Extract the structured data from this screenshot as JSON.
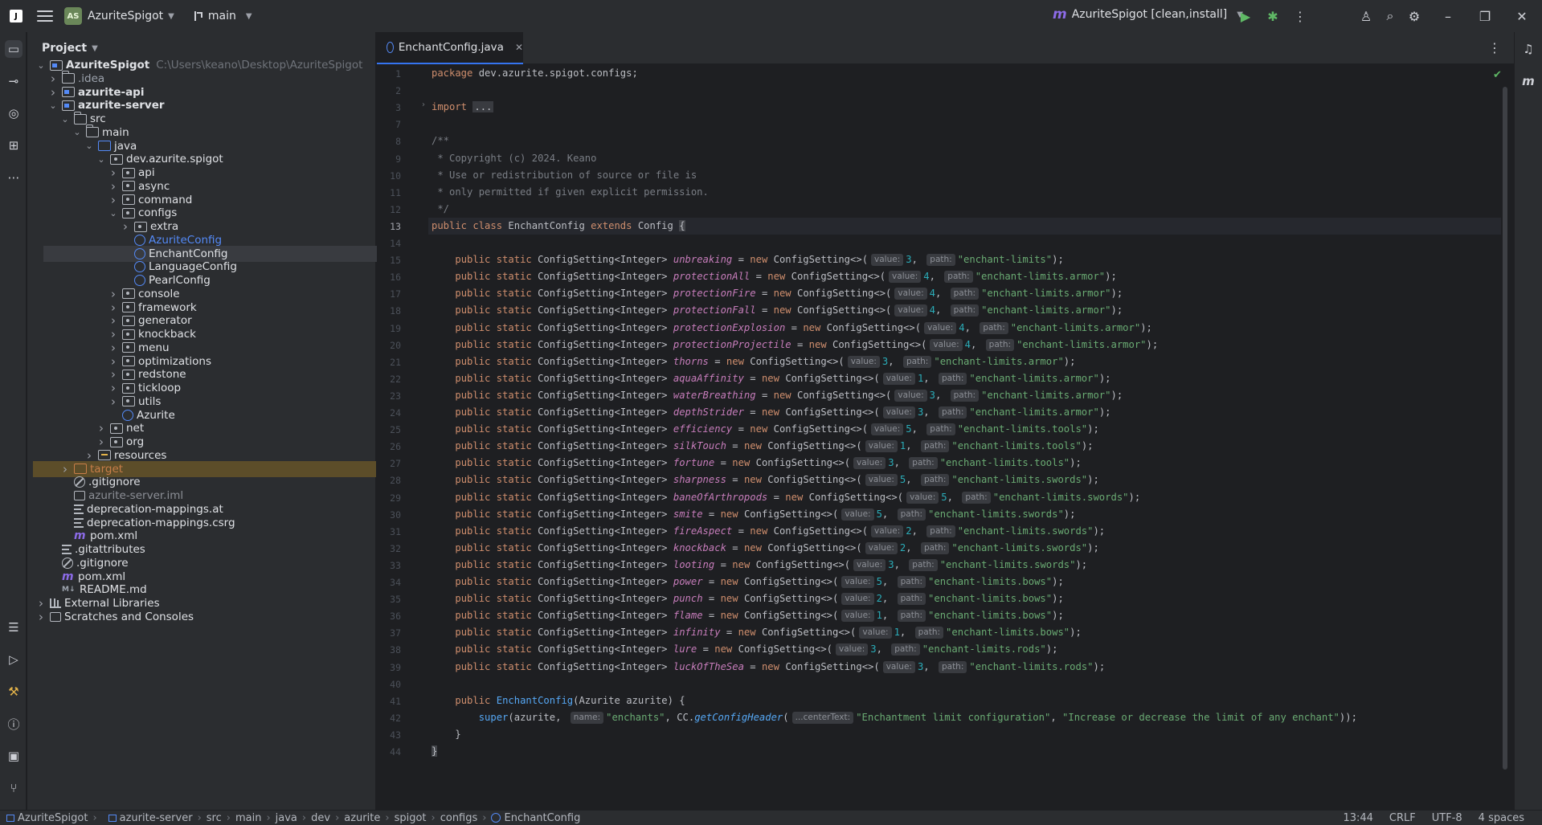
{
  "titlebar": {
    "project_badge": "AS",
    "project_name": "AzuriteSpigot",
    "branch": "main",
    "run_config": "AzuriteSpigot [clean,install]",
    "ide_logo": "J"
  },
  "project_panel": {
    "title": "Project",
    "root_path": "C:\\Users\\keano\\Desktop\\AzuriteSpigot",
    "rows": [
      {
        "label": "AzuriteSpigot",
        "icon": "module",
        "arrow": "open"
      },
      {
        "label": ".idea",
        "icon": "folder",
        "arrow": "closed"
      },
      {
        "label": "azurite-api",
        "icon": "module",
        "arrow": "closed"
      },
      {
        "label": "azurite-server",
        "icon": "module",
        "arrow": "open"
      },
      {
        "label": "src",
        "icon": "folder",
        "arrow": "open"
      },
      {
        "label": "main",
        "icon": "folder",
        "arrow": "open"
      },
      {
        "label": "java",
        "icon": "srcfolder",
        "arrow": "open"
      },
      {
        "label": "dev.azurite.spigot",
        "icon": "pkg",
        "arrow": "open"
      },
      {
        "label": "api",
        "icon": "pkg",
        "arrow": "closed"
      },
      {
        "label": "async",
        "icon": "pkg",
        "arrow": "closed"
      },
      {
        "label": "command",
        "icon": "pkg",
        "arrow": "closed"
      },
      {
        "label": "configs",
        "icon": "pkg",
        "arrow": "open"
      },
      {
        "label": "extra",
        "icon": "pkg",
        "arrow": "closed"
      },
      {
        "label": "AzuriteConfig",
        "icon": "cls",
        "arrow": "none"
      },
      {
        "label": "EnchantConfig",
        "icon": "cls",
        "arrow": "none"
      },
      {
        "label": "LanguageConfig",
        "icon": "cls",
        "arrow": "none"
      },
      {
        "label": "PearlConfig",
        "icon": "cls",
        "arrow": "none"
      },
      {
        "label": "console",
        "icon": "pkg",
        "arrow": "closed"
      },
      {
        "label": "framework",
        "icon": "pkg",
        "arrow": "closed"
      },
      {
        "label": "generator",
        "icon": "pkg",
        "arrow": "closed"
      },
      {
        "label": "knockback",
        "icon": "pkg",
        "arrow": "closed"
      },
      {
        "label": "menu",
        "icon": "pkg",
        "arrow": "closed"
      },
      {
        "label": "optimizations",
        "icon": "pkg",
        "arrow": "closed"
      },
      {
        "label": "redstone",
        "icon": "pkg",
        "arrow": "closed"
      },
      {
        "label": "tickloop",
        "icon": "pkg",
        "arrow": "closed"
      },
      {
        "label": "utils",
        "icon": "pkg",
        "arrow": "closed"
      },
      {
        "label": "Azurite",
        "icon": "cls",
        "arrow": "none"
      },
      {
        "label": "net",
        "icon": "pkg",
        "arrow": "closed"
      },
      {
        "label": "org",
        "icon": "pkg",
        "arrow": "closed"
      },
      {
        "label": "resources",
        "icon": "res",
        "arrow": "closed"
      },
      {
        "label": "target",
        "icon": "excl",
        "arrow": "closed"
      },
      {
        "label": ".gitignore",
        "icon": "ign",
        "arrow": "none"
      },
      {
        "label": "azurite-server.iml",
        "icon": "iml",
        "arrow": "none"
      },
      {
        "label": "deprecation-mappings.at",
        "icon": "txt",
        "arrow": "none"
      },
      {
        "label": "deprecation-mappings.csrg",
        "icon": "txt",
        "arrow": "none"
      },
      {
        "label": "pom.xml",
        "icon": "mvn",
        "arrow": "none"
      },
      {
        "label": ".gitattributes",
        "icon": "txt",
        "arrow": "none"
      },
      {
        "label": ".gitignore",
        "icon": "ign",
        "arrow": "none"
      },
      {
        "label": "pom.xml",
        "icon": "mvn",
        "arrow": "none"
      },
      {
        "label": "README.md",
        "icon": "md",
        "arrow": "none"
      },
      {
        "label": "External Libraries",
        "icon": "lib",
        "arrow": "closed"
      },
      {
        "label": "Scratches and Consoles",
        "icon": "scr",
        "arrow": "closed"
      }
    ]
  },
  "editor": {
    "tab_label": "EnchantConfig.java",
    "package_line": "dev.azurite.spigot.configs",
    "import_fold": "...",
    "comment_lines": [
      "/**",
      " * Copyright (c) 2024. Keano",
      " * Use or redistribution of source or file is",
      " * only permitted if given explicit permission.",
      " */"
    ],
    "class_name": "EnchantConfig",
    "super_class": "Config",
    "field_type": "ConfigSetting<Integer>",
    "ctor_type": "ConfigSetting<>",
    "hint_value": "value:",
    "hint_path": "path:",
    "settings": [
      {
        "name": "unbreaking",
        "value": "3",
        "path": "\"enchant-limits\""
      },
      {
        "name": "protectionAll",
        "value": "4",
        "path": "\"enchant-limits.armor\""
      },
      {
        "name": "protectionFire",
        "value": "4",
        "path": "\"enchant-limits.armor\""
      },
      {
        "name": "protectionFall",
        "value": "4",
        "path": "\"enchant-limits.armor\""
      },
      {
        "name": "protectionExplosion",
        "value": "4",
        "path": "\"enchant-limits.armor\""
      },
      {
        "name": "protectionProjectile",
        "value": "4",
        "path": "\"enchant-limits.armor\""
      },
      {
        "name": "thorns",
        "value": "3",
        "path": "\"enchant-limits.armor\""
      },
      {
        "name": "aquaAffinity",
        "value": "1",
        "path": "\"enchant-limits.armor\""
      },
      {
        "name": "waterBreathing",
        "value": "3",
        "path": "\"enchant-limits.armor\""
      },
      {
        "name": "depthStrider",
        "value": "3",
        "path": "\"enchant-limits.armor\""
      },
      {
        "name": "efficiency",
        "value": "5",
        "path": "\"enchant-limits.tools\""
      },
      {
        "name": "silkTouch",
        "value": "1",
        "path": "\"enchant-limits.tools\""
      },
      {
        "name": "fortune",
        "value": "3",
        "path": "\"enchant-limits.tools\""
      },
      {
        "name": "sharpness",
        "value": "5",
        "path": "\"enchant-limits.swords\""
      },
      {
        "name": "baneOfArthropods",
        "value": "5",
        "path": "\"enchant-limits.swords\""
      },
      {
        "name": "smite",
        "value": "5",
        "path": "\"enchant-limits.swords\""
      },
      {
        "name": "fireAspect",
        "value": "2",
        "path": "\"enchant-limits.swords\""
      },
      {
        "name": "knockback",
        "value": "2",
        "path": "\"enchant-limits.swords\""
      },
      {
        "name": "looting",
        "value": "3",
        "path": "\"enchant-limits.swords\""
      },
      {
        "name": "power",
        "value": "5",
        "path": "\"enchant-limits.bows\""
      },
      {
        "name": "punch",
        "value": "2",
        "path": "\"enchant-limits.bows\""
      },
      {
        "name": "flame",
        "value": "1",
        "path": "\"enchant-limits.bows\""
      },
      {
        "name": "infinity",
        "value": "1",
        "path": "\"enchant-limits.bows\""
      },
      {
        "name": "lure",
        "value": "3",
        "path": "\"enchant-limits.rods\""
      },
      {
        "name": "luckOfTheSea",
        "value": "3",
        "path": "\"enchant-limits.rods\""
      }
    ],
    "ctor_param_type": "Azurite",
    "ctor_param": "azurite",
    "super_hint_name": "name:",
    "super_name": "\"enchants\"",
    "super_cc": "CC.",
    "super_fn": "getConfigHeader",
    "super_hint_center": "...centerText:",
    "super_arg1": "\"Enchantment limit configuration\"",
    "super_arg2": "\"Increase or decrease the limit of any enchant\"",
    "line_numbers": [
      "1",
      "2",
      "3",
      "7",
      "8",
      "9",
      "10",
      "11",
      "12",
      "13",
      "14",
      "15",
      "16",
      "17",
      "18",
      "19",
      "20",
      "21",
      "22",
      "23",
      "24",
      "25",
      "26",
      "27",
      "28",
      "29",
      "30",
      "31",
      "32",
      "33",
      "34",
      "35",
      "36",
      "37",
      "38",
      "39",
      "40",
      "41",
      "42",
      "43",
      "44"
    ],
    "current_line": "13"
  },
  "statusbar": {
    "breadcrumbs": [
      "AzuriteSpigot",
      "azurite-server",
      "src",
      "main",
      "java",
      "dev",
      "azurite",
      "spigot",
      "configs",
      "EnchantConfig"
    ],
    "position": "13:44",
    "line_sep": "CRLF",
    "encoding": "UTF-8",
    "indent": "4 spaces"
  }
}
